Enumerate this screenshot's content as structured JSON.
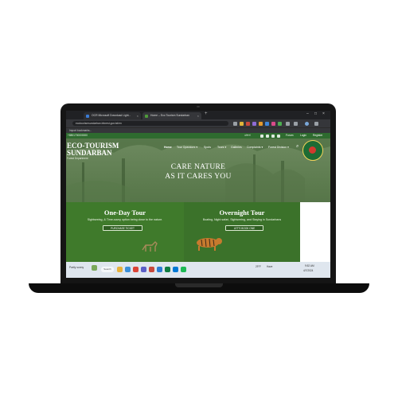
{
  "browser": {
    "tabs": [
      {
        "label": "OCR Microsoft Download Light...",
        "close": "×"
      },
      {
        "label": "Home – Eco Tourism Sundarban",
        "close": "×"
      }
    ],
    "new_tab": "+",
    "url": "ecotourismsundarban.bforest.gov.bd/en",
    "bookmarks_text": "Import bookmarks...",
    "window_controls": [
      "–",
      "□",
      "×"
    ]
  },
  "site": {
    "top_phone": "+8801700000000",
    "top_links": {
      "lang": "বাংলা",
      "forum": "Forum",
      "login": "Login",
      "register": "Register"
    },
    "logo_line1": "ECO-TOURISM",
    "logo_line2": "SUNDARBAN",
    "logo_sub": "Forest Department",
    "menu": [
      {
        "label": "Home"
      },
      {
        "label": "Tour Operators ▾"
      },
      {
        "label": "Spots"
      },
      {
        "label": "Tours ▾"
      },
      {
        "label": "Galleries"
      },
      {
        "label": "Complaints ▾"
      },
      {
        "label": "Forest Division ▾"
      }
    ],
    "search_icon": "⌕",
    "headline_1": "CARE NATURE",
    "headline_2": "AS IT CARES YOU",
    "panels": [
      {
        "title": "One-Day Tour",
        "desc": "Sightseeing, & Time-savvy option being close to the nature.",
        "button": "PURCHASE TICKET"
      },
      {
        "title": "Overnight Tour",
        "desc": "Boating, Night safari, Sightseeing, and Staying in Sundarbans",
        "button": "LET'S BOOK ONE"
      }
    ]
  },
  "taskbar": {
    "weather": "Partly sunny",
    "search_label": "Search",
    "temperature": "29°F",
    "haze": "Haze",
    "time": "9:52 AM",
    "date": "4/7/2024"
  },
  "colors": {
    "forest_green": "#3f7a2b",
    "top_strip": "#2e6b2f",
    "seal_gold": "#f3d35a",
    "seal_red": "#d23a2e"
  }
}
